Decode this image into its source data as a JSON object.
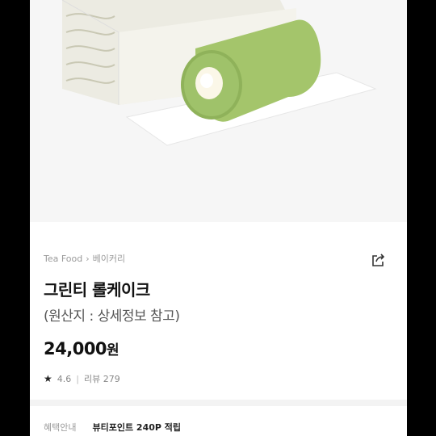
{
  "product": {
    "image_alt": "green tea roll cake with box",
    "breadcrumb": [
      "Tea Food",
      "베이커리"
    ],
    "title": "그린티 롤케이크",
    "origin": "(원산지 : 상세정보 참고)",
    "price_value": "24,000",
    "price_unit": "원",
    "rating": "4.6",
    "review_label": "리뷰 279"
  },
  "benefit": {
    "label": "혜택안내",
    "value": "뷰티포인트 240P 적립"
  },
  "icons": {
    "share": "share-icon",
    "chevron": "chevron-right-icon",
    "star": "star-icon"
  },
  "colors": {
    "matcha": "#9fc26a",
    "cream": "#fbf7e8",
    "text": "#111111"
  }
}
